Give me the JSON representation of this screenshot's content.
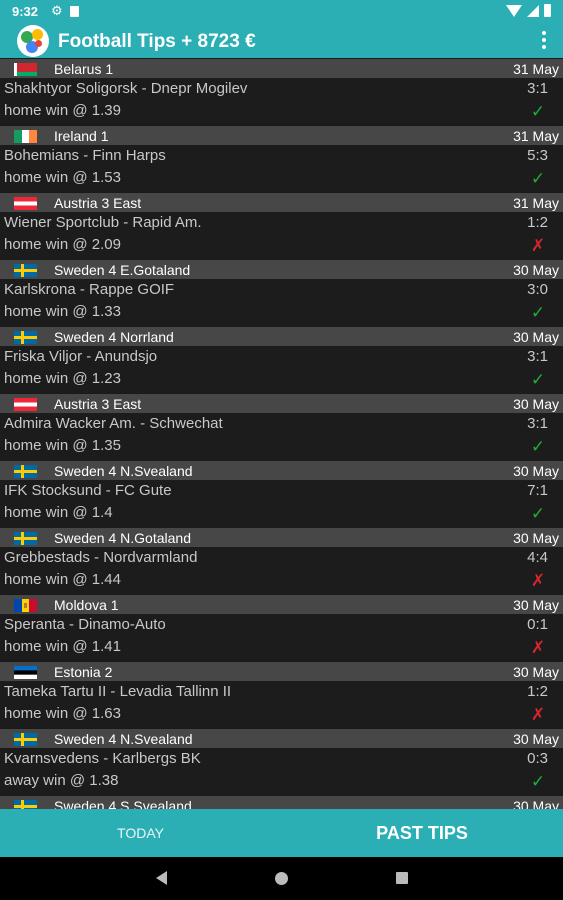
{
  "status_bar": {
    "time": "9:32"
  },
  "app_bar": {
    "title": "Football Tips + 8723 €"
  },
  "tips": [
    {
      "league": "Belarus 1",
      "country": "belarus",
      "date": "31 May",
      "match": "Shakhtyor Soligorsk - Dnepr Mogilev",
      "score": "3:1",
      "pick": "home win @ 1.39",
      "result": "win"
    },
    {
      "league": "Ireland 1",
      "country": "ireland",
      "date": "31 May",
      "match": "Bohemians - Finn Harps",
      "score": "5:3",
      "pick": "home win @ 1.53",
      "result": "win"
    },
    {
      "league": "Austria 3 East",
      "country": "austria",
      "date": "31 May",
      "match": "Wiener Sportclub - Rapid Am.",
      "score": "1:2",
      "pick": "home win @ 2.09",
      "result": "loss"
    },
    {
      "league": "Sweden 4 E.Gotaland",
      "country": "sweden",
      "date": "30 May",
      "match": "Karlskrona - Rappe GOIF",
      "score": "3:0",
      "pick": "home win @ 1.33",
      "result": "win"
    },
    {
      "league": "Sweden 4 Norrland",
      "country": "sweden",
      "date": "30 May",
      "match": "Friska Viljor - Anundsjo",
      "score": "3:1",
      "pick": "home win @ 1.23",
      "result": "win"
    },
    {
      "league": "Austria 3 East",
      "country": "austria",
      "date": "30 May",
      "match": "Admira Wacker Am. - Schwechat",
      "score": "3:1",
      "pick": "home win @ 1.35",
      "result": "win"
    },
    {
      "league": "Sweden 4 N.Svealand",
      "country": "sweden",
      "date": "30 May",
      "match": "IFK Stocksund - FC Gute",
      "score": "7:1",
      "pick": "home win @ 1.4",
      "result": "win"
    },
    {
      "league": "Sweden 4 N.Gotaland",
      "country": "sweden",
      "date": "30 May",
      "match": "Grebbestads - Nordvarmland",
      "score": "4:4",
      "pick": "home win @ 1.44",
      "result": "loss"
    },
    {
      "league": "Moldova 1",
      "country": "moldova",
      "date": "30 May",
      "match": "Speranta - Dinamo-Auto",
      "score": "0:1",
      "pick": "home win @ 1.41",
      "result": "loss"
    },
    {
      "league": "Estonia 2",
      "country": "estonia",
      "date": "30 May",
      "match": "Tameka Tartu II - Levadia Tallinn II",
      "score": "1:2",
      "pick": "home win @ 1.63",
      "result": "loss"
    },
    {
      "league": "Sweden 4 N.Svealand",
      "country": "sweden",
      "date": "30 May",
      "match": "Kvarnsvedens - Karlbergs BK",
      "score": "0:3",
      "pick": "away win @ 1.38",
      "result": "win"
    },
    {
      "league": "Sweden 4 S.Svealand",
      "country": "sweden",
      "date": "30 May",
      "match": "",
      "score": "",
      "pick": "",
      "result": ""
    }
  ],
  "result_icons": {
    "win": "✓",
    "loss": "✗"
  },
  "bottom_nav": {
    "today": "TODAY",
    "past_tips": "PAST TIPS",
    "active": "past_tips"
  },
  "colors": {
    "primary": "#2bafb5",
    "win": "#1fae36",
    "loss": "#d8262b",
    "header_bg": "#474747",
    "row_bg": "#1c1c1c"
  }
}
